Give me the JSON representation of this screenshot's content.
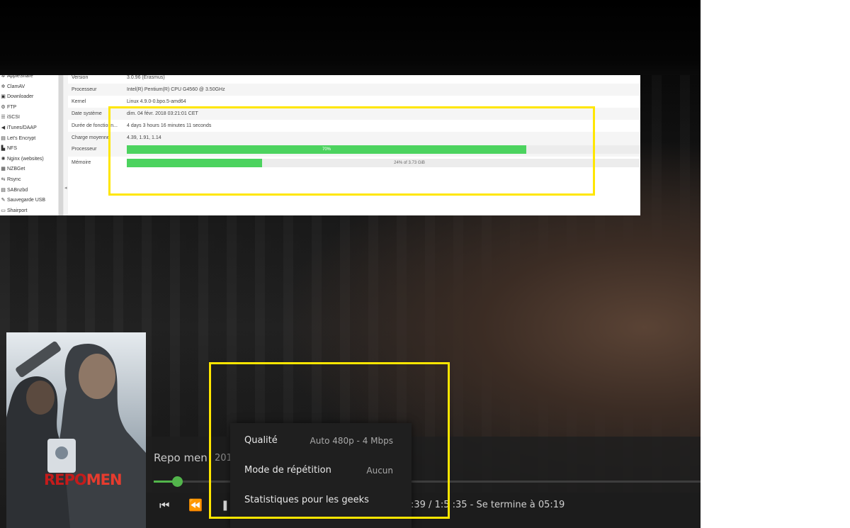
{
  "nas": {
    "sidebar": [
      {
        "icon": "gear-icon",
        "label": "AppleShare",
        "glyph": "✲"
      },
      {
        "icon": "gear-icon",
        "label": "ClamAV",
        "glyph": "✲"
      },
      {
        "icon": "download-icon",
        "label": "Downloader",
        "glyph": "▣"
      },
      {
        "icon": "ftp-icon",
        "label": "FTP",
        "glyph": "⚙"
      },
      {
        "icon": "server-icon",
        "label": "iSCSI",
        "glyph": "☰"
      },
      {
        "icon": "speaker-icon",
        "label": "iTunes/DAAP",
        "glyph": "◀"
      },
      {
        "icon": "lock-icon",
        "label": "Let's Encrypt",
        "glyph": "▤"
      },
      {
        "icon": "folder-icon",
        "label": "NFS",
        "glyph": "▙"
      },
      {
        "icon": "globe-icon",
        "label": "Nginx (websites)",
        "glyph": "✺"
      },
      {
        "icon": "grid-icon",
        "label": "NZBGet",
        "glyph": "▦"
      },
      {
        "icon": "sync-icon",
        "label": "Rsync",
        "glyph": "⇆"
      },
      {
        "icon": "grid-icon",
        "label": "SABnzbd",
        "glyph": "▤"
      },
      {
        "icon": "usb-icon",
        "label": "Sauvegarde USB",
        "glyph": "✎"
      },
      {
        "icon": "monitor-icon",
        "label": "Shairport",
        "glyph": "▭"
      }
    ],
    "collapse_glyph": "◂",
    "rows": [
      {
        "key": "Version",
        "value": "3.0.96 (Erasmus)"
      },
      {
        "key": "Processeur",
        "value": "Intel(R) Pentium(R) CPU G4560 @ 3.50GHz"
      },
      {
        "key": "Kernel",
        "value": "Linux 4.9.0-0.bpo.5-amd64"
      },
      {
        "key": "Date système",
        "value": "dim. 04 févr. 2018 03:21:01 CET"
      },
      {
        "key": "Durée de fonctionn...",
        "value": "4 days 3 hours 16 minutes 11 seconds"
      },
      {
        "key": "Charge moyenne",
        "value": "4.39, 1.91, 1.14"
      }
    ],
    "cpu": {
      "key": "Processeur",
      "label": "70%",
      "fraction": 0.779
    },
    "memory": {
      "key": "Mémoire",
      "label": "24% of 3.73 GiB",
      "fraction": 0.264
    }
  },
  "player": {
    "title": "Repo men",
    "year": "201",
    "progress_fraction": 0.043,
    "time": ":39 / 1:5   :35  -  Se termine à 05:19",
    "controls": {
      "prev": "⏮",
      "rewind": "⏪",
      "pause": "❚❚"
    }
  },
  "menu": [
    {
      "label": "Qualité",
      "value": "Auto 480p - 4 Mbps"
    },
    {
      "label": "Mode de répétition",
      "value": "Aucun"
    },
    {
      "label": "Statistiques pour les geeks",
      "value": ""
    }
  ],
  "poster_text": {
    "title_left": "REPO",
    "title_right": "MEN"
  },
  "colors": {
    "highlight": "#ffe600",
    "bar": "#4cd35f",
    "accent": "#52b54b"
  }
}
